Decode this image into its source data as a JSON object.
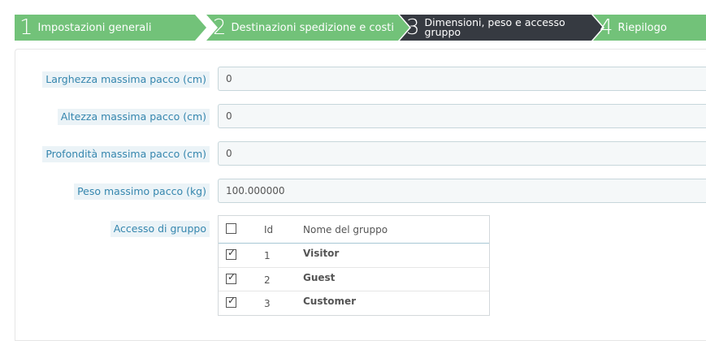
{
  "wizard": {
    "steps": [
      {
        "num": "1",
        "label": "Impostazioni generali"
      },
      {
        "num": "2",
        "label": "Destinazioni spedizione e costi"
      },
      {
        "num": "3",
        "label_line1": "Dimensioni, peso e accesso",
        "label_line2": "gruppo"
      },
      {
        "num": "4",
        "label": "Riepilogo"
      }
    ]
  },
  "form": {
    "max_width": {
      "label": "Larghezza massima pacco (cm)",
      "value": "0"
    },
    "max_height": {
      "label": "Altezza massima pacco (cm)",
      "value": "0"
    },
    "max_depth": {
      "label": "Profondità massima pacco (cm)",
      "value": "0"
    },
    "max_weight": {
      "label": "Peso massimo pacco (kg)",
      "value": "100.000000"
    },
    "group_access": {
      "label": "Accesso di gruppo",
      "headers": {
        "id": "Id",
        "name": "Nome del gruppo"
      },
      "rows": [
        {
          "id": "1",
          "name": "Visitor",
          "checked": true
        },
        {
          "id": "2",
          "name": "Guest",
          "checked": true
        },
        {
          "id": "3",
          "name": "Customer",
          "checked": true
        }
      ]
    }
  },
  "colors": {
    "step_done": "#72c279",
    "step_active": "#363a41",
    "label_text": "#3586ae"
  },
  "icons": {
    "check": "checkmark-icon"
  }
}
